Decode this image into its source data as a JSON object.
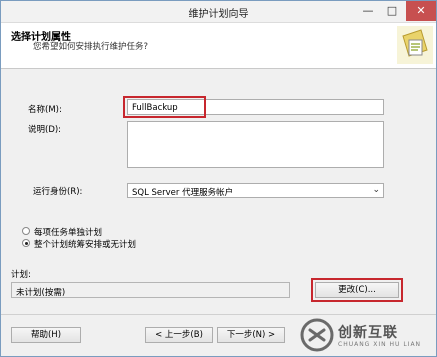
{
  "window": {
    "title": "维护计划向导",
    "minimize_glyph": "—",
    "maximize_glyph": "□",
    "close_glyph": "✕"
  },
  "header": {
    "title": "选择计划属性",
    "subtitle": "您希望如何安排执行维护任务?",
    "art_icon": "wizard-document-icon"
  },
  "form": {
    "name_label": "名称(M):",
    "name_value": "FullBackup",
    "description_label": "说明(D):",
    "description_value": "",
    "run_as_label": "运行身份(R):",
    "run_as_value": "SQL Server 代理服务帐户",
    "radio_options": [
      {
        "label": "每项任务单独计划",
        "checked": false
      },
      {
        "label": "整个计划统筹安排或无计划",
        "checked": true
      }
    ],
    "schedule_label": "计划:",
    "schedule_value": "未计划(按需)",
    "change_button": "更改(C)..."
  },
  "footer": {
    "help_button": "帮助(H)",
    "back_button": "< 上一步(B)",
    "next_button": "下一步(N) >"
  },
  "watermark": {
    "text_cn": "创新互联",
    "text_en": "CHUANG XIN HU LIAN"
  },
  "colors": {
    "highlight": "#c7272e",
    "close_button": "#c75050"
  }
}
